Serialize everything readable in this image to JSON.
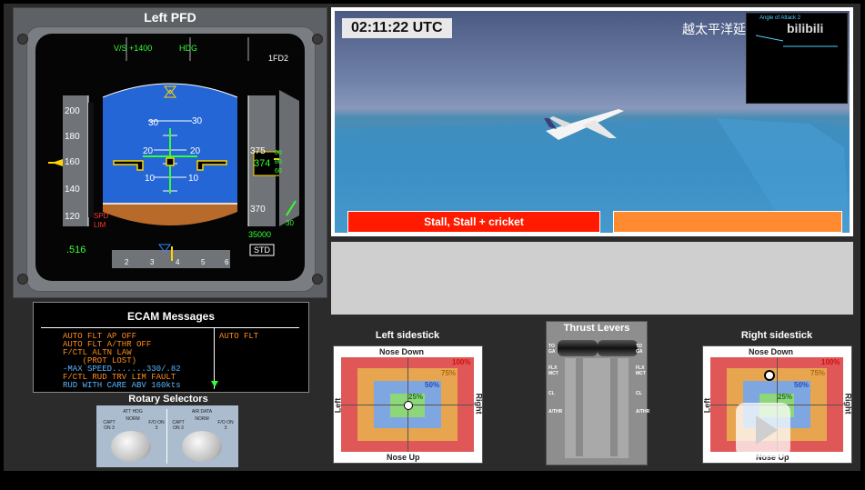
{
  "pfd": {
    "title": "Left PFD",
    "fma_vs": "V/S +1400",
    "fma_hdg": "HDG",
    "fma_fd": "1FD2",
    "speed_ticks": [
      "200",
      "180",
      "160",
      "140",
      "120"
    ],
    "spd_lim_1": "SPD",
    "spd_lim_2": "LIM",
    "mach": ".516",
    "alt_375": "375",
    "alt_374": "374",
    "alt_370": "370",
    "alt_tape_digits": [
      "00",
      "80",
      "60"
    ],
    "alt_target": "35000",
    "baro": "STD",
    "pitch_up": [
      "30",
      "30"
    ],
    "pitch_20": [
      "20",
      "20"
    ],
    "pitch_10": [
      "10",
      "10"
    ],
    "heading_ticks": [
      "2",
      "3",
      "4",
      "5",
      "6"
    ],
    "vs_indicator": "30"
  },
  "video": {
    "utc": "02:11:22 UTC",
    "channel_title": "越太平洋延程飛行",
    "watermark": "bilibili",
    "inset_title": "Angle of Attack 2",
    "alert_red": "Stall, Stall + cricket",
    "alert_orange": ""
  },
  "ecam": {
    "title": "ECAM Messages",
    "lines": [
      {
        "text": "AUTO FLT AP OFF",
        "color": "#ff8c1a"
      },
      {
        "text": "AUTO FLT A/THR OFF",
        "color": "#ff8c1a"
      },
      {
        "text": "F/CTL ALTN LAW",
        "color": "#ff8c1a"
      },
      {
        "text": "    (PROT LOST)",
        "color": "#ff8c1a"
      },
      {
        "text": "-MAX SPEED.......330/.82",
        "color": "#5ab4ff"
      },
      {
        "text": "F/CTL RUD TRV LIM FAULT",
        "color": "#ff8c1a"
      },
      {
        "text": "RUD WITH CARE ABV 160kts",
        "color": "#5ab4ff"
      }
    ],
    "right_msg": "AUTO FLT"
  },
  "rotary": {
    "title": "Rotary Selectors",
    "left_top": "ATT HDG",
    "left_norm": "NORM",
    "left_capt": "CAPT ON 3",
    "left_fo": "F/O ON 3",
    "right_top": "AIR DATA",
    "right_norm": "NORM",
    "right_capt": "CAPT ON 3",
    "right_fo": "F/O ON 3"
  },
  "left_stick": {
    "title": "Left sidestick",
    "top": "Nose Down",
    "bottom": "Nose Up",
    "left": "Left",
    "right": "Right",
    "p100": "100%",
    "p75": "75%",
    "p50": "50%",
    "p25": "25%"
  },
  "right_stick": {
    "title": "Right sidestick",
    "top": "Nose Down",
    "bottom": "Nose Up",
    "left": "Left",
    "right": "Right",
    "p100": "100%",
    "p75": "75%",
    "p50": "50%",
    "p25": "25%"
  },
  "thrust": {
    "title": "Thrust Levers",
    "left_ticks": [
      "TO GA",
      "FLX MCT",
      "CL",
      "A/THR"
    ],
    "right_ticks": [
      "TO GA",
      "FLX MCT",
      "CL",
      "A/THR"
    ]
  },
  "colors": {
    "stick_red": "#e05757",
    "stick_orange": "#e8a550",
    "stick_blue": "#7ea6e0",
    "stick_green": "#8ed67a"
  }
}
